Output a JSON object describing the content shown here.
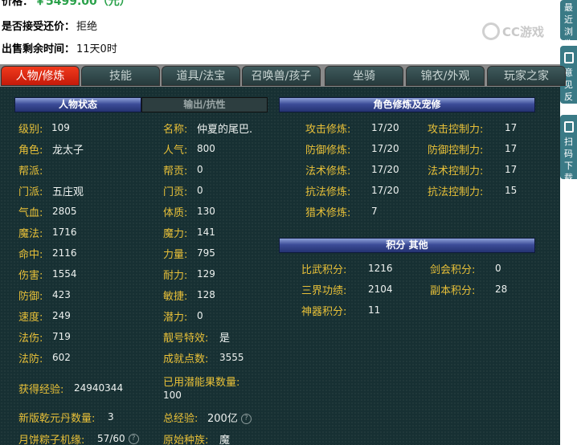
{
  "info": {
    "price_label": "价格：",
    "price_value": "￥5499.00（元）",
    "accept_label": "是否接受还价：",
    "accept_value": "拒绝",
    "remain_label": "出售剩余时间：",
    "remain_value": "11天0时",
    "logo_text": "CC游戏"
  },
  "side": {
    "b1": "最近浏览",
    "b2": "意见反馈",
    "b3": "扫码下载"
  },
  "tabs": [
    "人物/修炼",
    "技能",
    "道具/法宝",
    "召唤兽/孩子",
    "坐骑",
    "锦衣/外观",
    "玩家之家"
  ],
  "left_headers": {
    "status": "人物状态",
    "output": "输出/抗性"
  },
  "col1": [
    {
      "label": "级别:",
      "value": "109"
    },
    {
      "label": "角色:",
      "value": "龙太子"
    },
    {
      "label": "帮派:",
      "value": ""
    },
    {
      "label": "门派:",
      "value": "五庄观"
    },
    {
      "label": "气血:",
      "value": "2805"
    },
    {
      "label": "魔法:",
      "value": "1716"
    },
    {
      "label": "命中:",
      "value": "2116"
    },
    {
      "label": "伤害:",
      "value": "1554"
    },
    {
      "label": "防御:",
      "value": "423"
    },
    {
      "label": "速度:",
      "value": "249"
    },
    {
      "label": "法伤:",
      "value": "719"
    },
    {
      "label": "法防:",
      "value": "602"
    }
  ],
  "col2": [
    {
      "label": "名称:",
      "value": "仲夏的尾巴."
    },
    {
      "label": "人气:",
      "value": "800"
    },
    {
      "label": "帮贡:",
      "value": "0"
    },
    {
      "label": "门贡:",
      "value": "0"
    },
    {
      "label": "体质:",
      "value": "130"
    },
    {
      "label": "魔力:",
      "value": "141"
    },
    {
      "label": "力量:",
      "value": "795"
    },
    {
      "label": "耐力:",
      "value": "129"
    },
    {
      "label": "敏捷:",
      "value": "128"
    },
    {
      "label": "潜力:",
      "value": "0"
    },
    {
      "label": "靓号特效:",
      "value": "是"
    },
    {
      "label": "成就点数:",
      "value": "3555"
    }
  ],
  "bottom": {
    "exp_label": "获得经验:",
    "exp_value": "24940344",
    "used_label": "已用潜能果数量:",
    "used_value": "100",
    "qianyuan_label": "新版乾元丹数量:",
    "qianyuan_value": "3",
    "total_exp_label": "总经验:",
    "total_exp_value": "200亿",
    "mooncake_label": "月饼粽子机缘:",
    "mooncake_value": "57/60",
    "race_label": "原始种族:",
    "race_value": "魔",
    "help_glyph": "?"
  },
  "cultivation": {
    "header": "角色修炼及宠修",
    "left": [
      {
        "label": "攻击修炼:",
        "value": "17/20"
      },
      {
        "label": "防御修炼:",
        "value": "17/20"
      },
      {
        "label": "法术修炼:",
        "value": "17/20"
      },
      {
        "label": "抗法修炼:",
        "value": "17/20"
      },
      {
        "label": "猎术修炼:",
        "value": "7"
      }
    ],
    "right": [
      {
        "label": "攻击控制力:",
        "value": "17"
      },
      {
        "label": "防御控制力:",
        "value": "17"
      },
      {
        "label": "法术控制力:",
        "value": "17"
      },
      {
        "label": "抗法控制力:",
        "value": "15"
      }
    ]
  },
  "points": {
    "header": "积分 其他",
    "left": [
      {
        "label": "比武积分:",
        "value": "1216"
      },
      {
        "label": "三界功绩:",
        "value": "2104"
      },
      {
        "label": "神器积分:",
        "value": "11"
      }
    ],
    "right": [
      {
        "label": "剑会积分:",
        "value": "0"
      },
      {
        "label": "副本积分:",
        "value": "28"
      }
    ]
  }
}
